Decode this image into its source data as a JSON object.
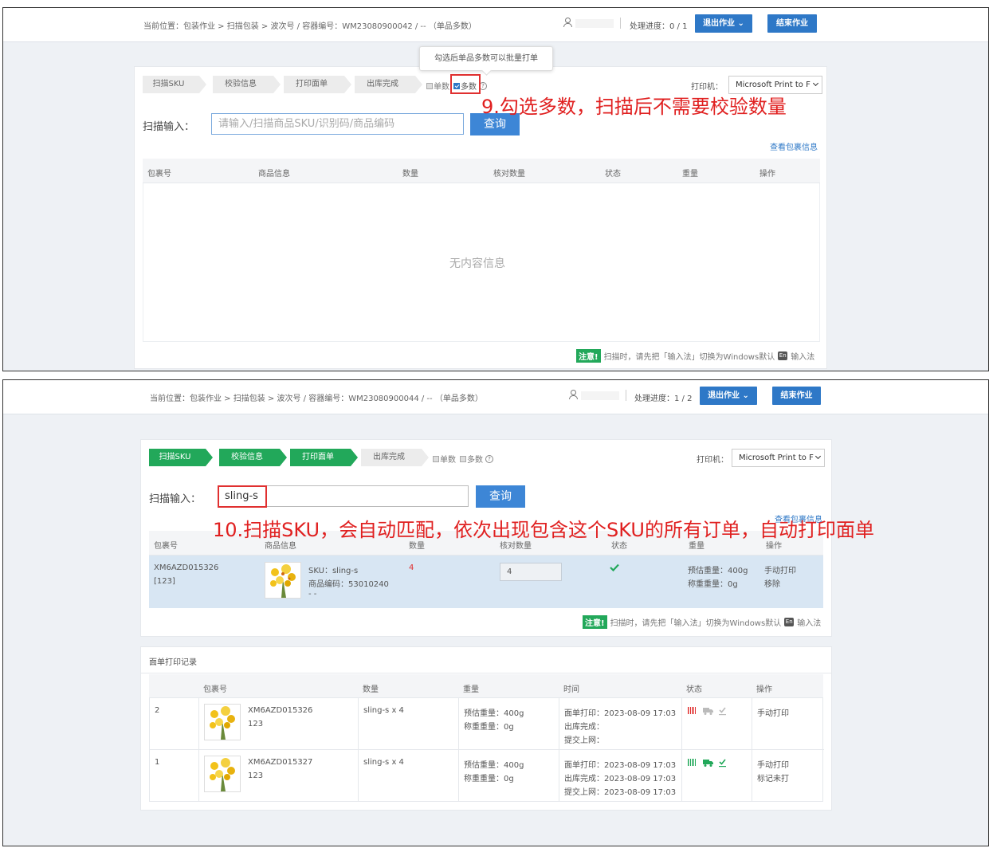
{
  "screen1": {
    "breadcrumb": "当前位置：包装作业 > 扫描包装 > 波次号 / 容器编号：WM23080900042 / -- （单品多数）",
    "progress": "处理进度：0 / 1",
    "exit_btn": "退出作业 ⌄",
    "finish_btn": "结束作业",
    "tooltip": "勾选后单品多数可以批量打单",
    "steps": [
      "扫描SKU",
      "校验信息",
      "打印面单",
      "出库完成"
    ],
    "single_label": "单数",
    "multi_label": "多数",
    "multi_checked": true,
    "printer_label": "打印机：",
    "printer_value": "Microsoft Print to F",
    "scan_label": "扫描输入：",
    "scan_placeholder": "请输入/扫描商品SKU/识别码/商品编码",
    "query_btn": "查询",
    "view_pkg_link": "查看包裹信息",
    "columns": [
      "包裹号",
      "商品信息",
      "数量",
      "核对数量",
      "状态",
      "重量",
      "操作"
    ],
    "empty_text": "无内容信息",
    "notice_tag": "注意!",
    "notice_text": "扫描时，请先把「输入法」切换为Windows默认",
    "notice_en": "En",
    "notice_end": "输入法",
    "annotation": "9.勾选多数，扫描后不需要校验数量"
  },
  "screen2": {
    "breadcrumb": "当前位置：包装作业 > 扫描包装 > 波次号 / 容器编号：WM23080900044 / -- （单品多数）",
    "progress": "处理进度：1 / 2",
    "exit_btn": "退出作业 ⌄",
    "finish_btn": "结束作业",
    "steps": [
      "扫描SKU",
      "校验信息",
      "打印面单",
      "出库完成"
    ],
    "single_label": "单数",
    "multi_label": "多数",
    "printer_label": "打印机：",
    "printer_value": "Microsoft Print to F",
    "scan_label": "扫描输入：",
    "scan_value": "sling-s",
    "query_btn": "查询",
    "view_pkg_link": "查看包裹信息",
    "columns": [
      "包裹号",
      "商品信息",
      "数量",
      "核对数量",
      "状态",
      "重量",
      "操作"
    ],
    "row": {
      "pkg_no": "XM6AZD015326",
      "pkg_sub": "[123]",
      "sku": "SKU：sling-s",
      "code": "商品编码：53010240",
      "dash": "- -",
      "qty": "4",
      "check_qty": "4",
      "est_weight": "预估重量：400g",
      "act_weight": "称重重量：0g",
      "action1": "手动打印",
      "action2": "移除"
    },
    "notice_tag": "注意!",
    "notice_text": "扫描时，请先把「输入法」切换为Windows默认",
    "notice_en": "En",
    "notice_end": "输入法",
    "annotation": "10.扫描SKU，会自动匹配，依次出现包含这个SKU的所有订单，自动打印面单",
    "log_title": "面单打印记录",
    "log_columns": [
      "包裹号",
      "数量",
      "重量",
      "时间",
      "状态",
      "操作"
    ],
    "log_rows": [
      {
        "idx": "2",
        "pkg": "XM6AZD015326",
        "sub": "123",
        "qty": "sling-s x 4",
        "w1": "预估重量：400g",
        "w2": "称重重量：0g",
        "t1": "面单打印：2023-08-09 17:03",
        "t2": "出库完成：",
        "t3": "提交上网：",
        "act1": "手动打印",
        "act2": ""
      },
      {
        "idx": "1",
        "pkg": "XM6AZD015327",
        "sub": "123",
        "qty": "sling-s x 4",
        "w1": "预估重量：400g",
        "w2": "称重重量：0g",
        "t1": "面单打印：2023-08-09 17:03",
        "t2": "出库完成：2023-08-09 17:03",
        "t3": "提交上网：2023-08-09 17:03",
        "act1": "手动打印",
        "act2": "标记未打"
      }
    ]
  },
  "colors": {
    "accent": "#2e78c7",
    "green": "#22a85a",
    "red_annotation": "#e02020"
  }
}
